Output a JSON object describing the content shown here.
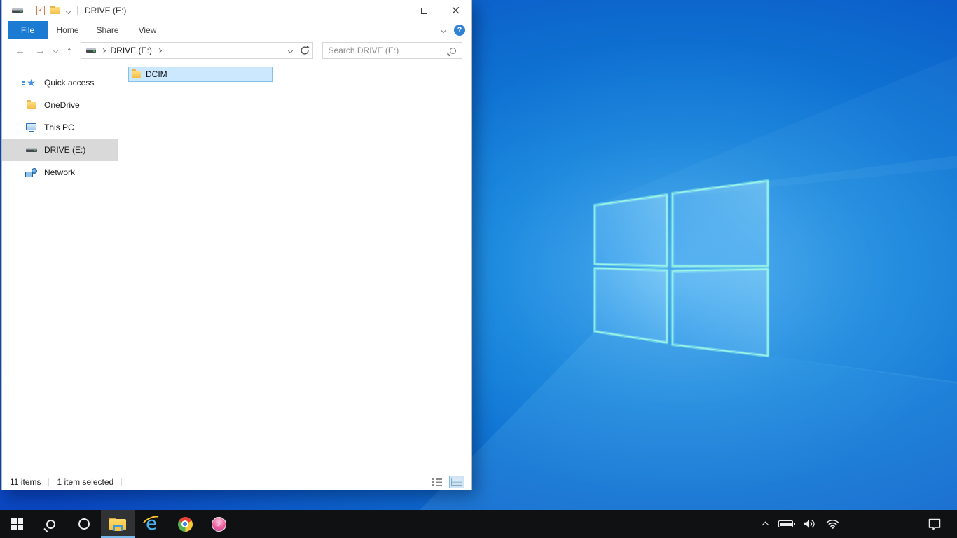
{
  "colors": {
    "accent_blue": "#1b7ad1",
    "selection_fill": "#cce8ff",
    "selection_border": "#84c0ea",
    "sidebar_selected": "#d9d9d9",
    "taskbar_bg": "#101113",
    "taskbar_active_underline": "#79b8ea",
    "wallpaper_center": "#1f96ea",
    "wallpaper_corner": "#0a47c2"
  },
  "window": {
    "title": "DRIVE (E:)",
    "qat": {
      "properties_check": "✓"
    },
    "controls": {
      "close_glyph": "×"
    },
    "tabs": {
      "file": "File",
      "home": "Home",
      "share": "Share",
      "view": "View"
    },
    "ribbon": {
      "help": "?"
    },
    "nav": {
      "back": "←",
      "forward": "→",
      "up": "↑",
      "crumb": "DRIVE (E:)",
      "search_placeholder": "Search DRIVE (E:)"
    },
    "sidebar": {
      "items": [
        {
          "label": "Quick access",
          "icon": "quick-access-star",
          "star_glyph": "★"
        },
        {
          "label": "OneDrive",
          "icon": "folder"
        },
        {
          "label": "This PC",
          "icon": "monitor"
        },
        {
          "label": "DRIVE (E:)",
          "icon": "drive",
          "selected": true
        },
        {
          "label": "Network",
          "icon": "network"
        }
      ]
    },
    "files": [
      {
        "name": "DCIM",
        "icon": "folder",
        "selected": true
      }
    ],
    "status": {
      "items_count": "11 items",
      "selection": "1 item selected"
    }
  },
  "taskbar": {
    "ie_glyph": "e",
    "itunes_glyph": "♪",
    "buttons": [
      "start",
      "search",
      "cortana",
      "file-explorer",
      "internet-explorer",
      "chrome",
      "itunes"
    ],
    "tray": [
      "hidden-icons-chevron",
      "battery",
      "volume",
      "wifi",
      "action-center"
    ]
  }
}
